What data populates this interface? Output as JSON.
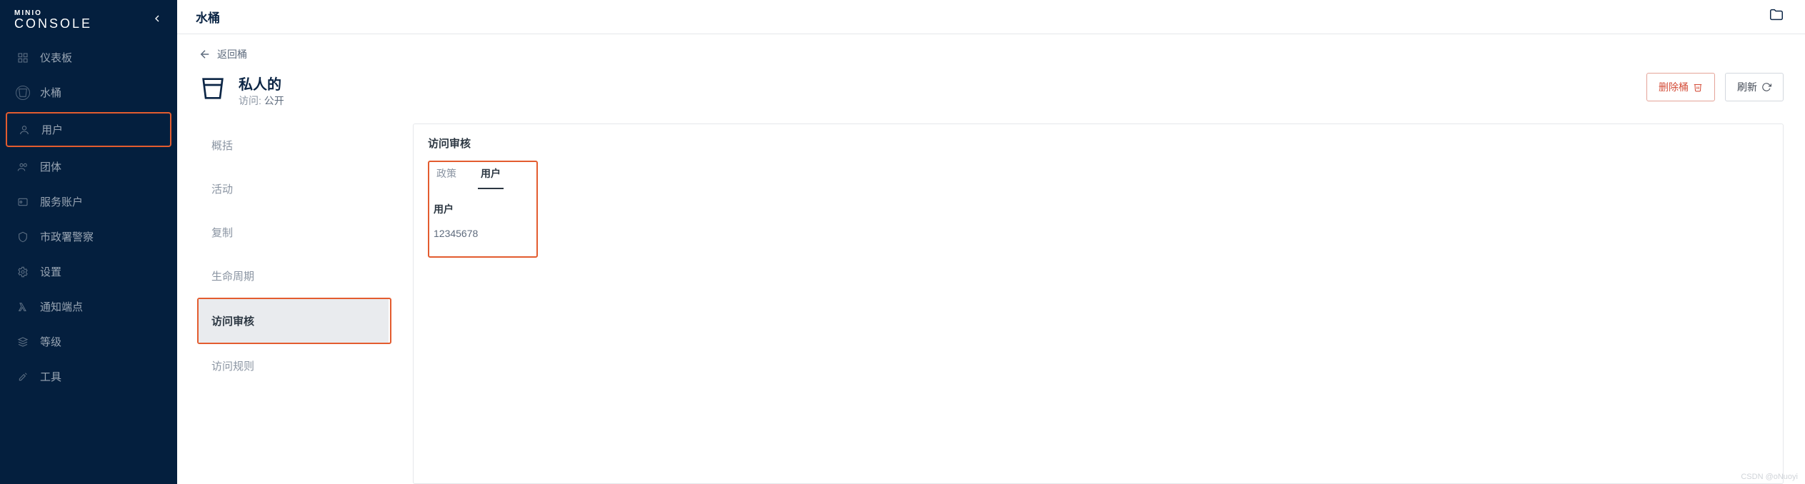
{
  "brand": {
    "top": "MINIO",
    "bottom": "CONSOLE"
  },
  "sidebar": {
    "items": [
      {
        "label": "仪表板",
        "icon": "dashboard-icon"
      },
      {
        "label": "水桶",
        "icon": "bucket-icon"
      },
      {
        "label": "用户",
        "icon": "user-icon"
      },
      {
        "label": "团体",
        "icon": "group-icon"
      },
      {
        "label": "服务账户",
        "icon": "service-account-icon"
      },
      {
        "label": "市政署警察",
        "icon": "shield-icon"
      },
      {
        "label": "设置",
        "icon": "gear-icon"
      },
      {
        "label": "通知端点",
        "icon": "lambda-icon"
      },
      {
        "label": "等级",
        "icon": "tier-icon"
      },
      {
        "label": "工具",
        "icon": "tools-icon"
      }
    ]
  },
  "topbar": {
    "title": "水桶"
  },
  "back": {
    "label": "返回桶"
  },
  "bucket": {
    "name": "私人的",
    "access_label": "访问:",
    "access_value": "公开"
  },
  "actions": {
    "delete": "删除桶",
    "refresh": "刷新"
  },
  "subtabs": [
    {
      "label": "概括"
    },
    {
      "label": "活动"
    },
    {
      "label": "复制"
    },
    {
      "label": "生命周期"
    },
    {
      "label": "访问审核",
      "active": true
    },
    {
      "label": "访问规则"
    }
  ],
  "panel": {
    "title": "访问审核",
    "tabs": [
      {
        "label": "政策"
      },
      {
        "label": "用户",
        "active": true
      }
    ],
    "field_label": "用户",
    "field_value": "12345678"
  },
  "watermark": "CSDN @oNuoyi"
}
